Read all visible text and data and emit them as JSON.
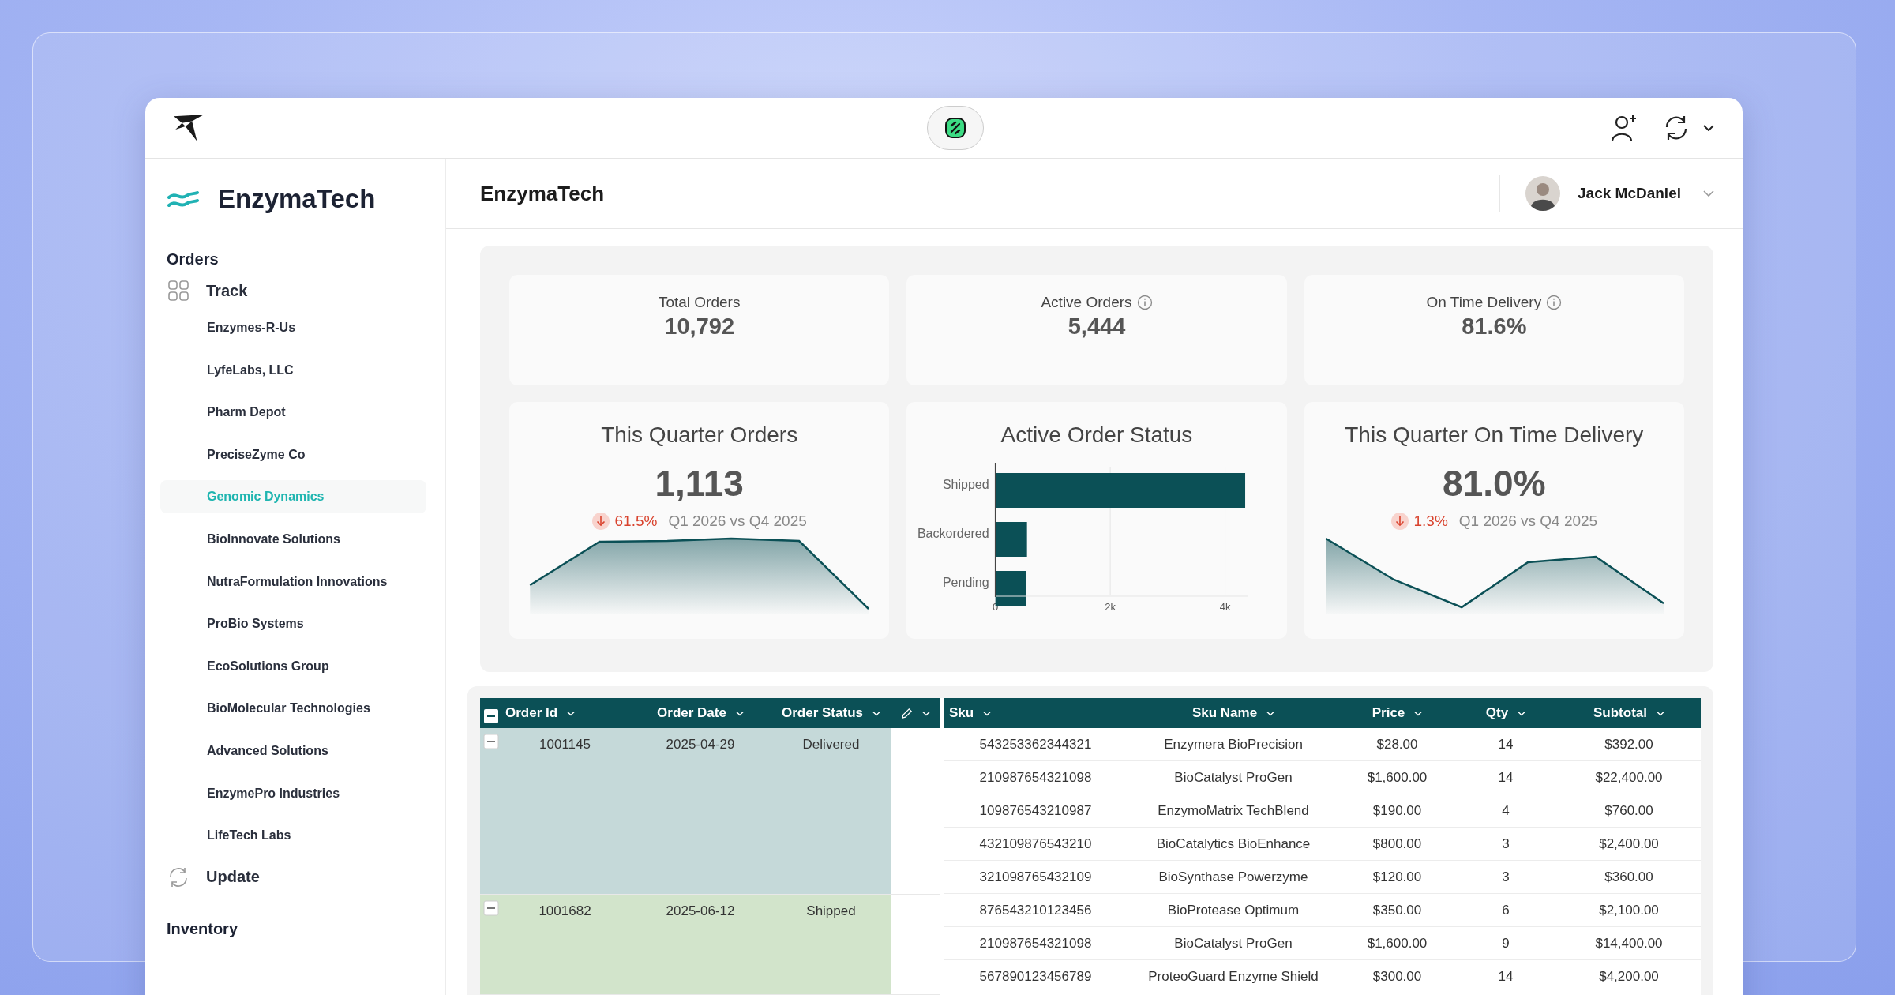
{
  "sidebar": {
    "brand": "EnzymaTech",
    "sections": [
      {
        "title": "Orders",
        "items": [
          {
            "label": "Track",
            "kind": "grid",
            "children": [
              {
                "label": "Enzymes-R-Us",
                "selected": false
              },
              {
                "label": "LyfeLabs, LLC",
                "selected": false
              },
              {
                "label": "Pharm Depot",
                "selected": false
              },
              {
                "label": "PreciseZyme Co",
                "selected": false
              },
              {
                "label": "Genomic Dynamics",
                "selected": true
              },
              {
                "label": "BioInnovate Solutions",
                "selected": false
              },
              {
                "label": "NutraFormulation Innovations",
                "selected": false
              },
              {
                "label": "ProBio Systems",
                "selected": false
              },
              {
                "label": "EcoSolutions Group",
                "selected": false
              },
              {
                "label": "BioMolecular Technologies",
                "selected": false
              },
              {
                "label": "Advanced Solutions",
                "selected": false
              },
              {
                "label": "EnzymePro Industries",
                "selected": false
              },
              {
                "label": "LifeTech Labs",
                "selected": false
              }
            ]
          },
          {
            "label": "Update",
            "kind": "refresh"
          }
        ]
      },
      {
        "title": "Inventory"
      }
    ]
  },
  "header": {
    "title": "EnzymaTech",
    "user": "Jack McDaniel"
  },
  "kpis": [
    {
      "label": "Total Orders",
      "value": "10,792",
      "info": false
    },
    {
      "label": "Active Orders",
      "value": "5,444",
      "info": true
    },
    {
      "label": "On Time Delivery",
      "value": "81.6%",
      "info": true
    }
  ],
  "chart_cards": [
    {
      "kind": "trend",
      "title": "This Quarter Orders",
      "value": "1,113",
      "delta": {
        "declining": true,
        "value": "61.5%",
        "period": "Q1 2026 vs Q4 2025"
      }
    },
    {
      "kind": "bars",
      "title": "Active Order Status",
      "chart_data": {
        "type": "bar",
        "orientation": "horizontal",
        "categories": [
          "Shipped",
          "Backordered",
          "Pending"
        ],
        "values": [
          4350,
          550,
          530
        ],
        "xlim": [
          0,
          4400
        ],
        "xticks": [
          0,
          {
            "value": 2000,
            "label": "2k"
          },
          {
            "value": 4000,
            "label": "4k"
          }
        ]
      }
    },
    {
      "kind": "trend",
      "title": "This Quarter On Time Delivery",
      "value": "81.0%",
      "delta": {
        "declining": true,
        "value": "1.3%",
        "period": "Q1 2026 vs Q4 2025"
      }
    }
  ],
  "table": {
    "order_columns": [
      "Order Id",
      "Order Date",
      "Order Status"
    ],
    "item_columns": [
      "Sku",
      "Sku Name",
      "Price",
      "Qty",
      "Subtotal"
    ],
    "orders": [
      {
        "order_id": "1001145",
        "order_date": "2025-04-29",
        "status": "Delivered",
        "color": "#c5d9d9",
        "expanded": true,
        "items": [
          {
            "sku": "543253362344321",
            "name": "Enzymera BioPrecision",
            "price": "$28.00",
            "qty": "14",
            "subtotal": "$392.00"
          },
          {
            "sku": "210987654321098",
            "name": "BioCatalyst ProGen",
            "price": "$1,600.00",
            "qty": "14",
            "subtotal": "$22,400.00"
          },
          {
            "sku": "109876543210987",
            "name": "EnzymoMatrix TechBlend",
            "price": "$190.00",
            "qty": "4",
            "subtotal": "$760.00"
          },
          {
            "sku": "432109876543210",
            "name": "BioCatalytics BioEnhance",
            "price": "$800.00",
            "qty": "3",
            "subtotal": "$2,400.00"
          },
          {
            "sku": "321098765432109",
            "name": "BioSynthase Powerzyme",
            "price": "$120.00",
            "qty": "3",
            "subtotal": "$360.00"
          }
        ]
      },
      {
        "order_id": "1001682",
        "order_date": "2025-06-12",
        "status": "Shipped",
        "color": "#d2e4cb",
        "expanded": true,
        "items": [
          {
            "sku": "876543210123456",
            "name": "BioProtease Optimum",
            "price": "$350.00",
            "qty": "6",
            "subtotal": "$2,100.00"
          },
          {
            "sku": "210987654321098",
            "name": "BioCatalyst ProGen",
            "price": "$1,600.00",
            "qty": "9",
            "subtotal": "$14,400.00"
          },
          {
            "sku": "567890123456789",
            "name": "ProteoGuard Enzyme Shield",
            "price": "$300.00",
            "qty": "14",
            "subtotal": "$4,200.00"
          }
        ]
      }
    ]
  }
}
